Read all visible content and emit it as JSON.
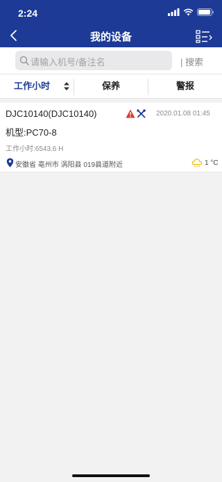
{
  "status_bar": {
    "time": "2:24"
  },
  "nav": {
    "title": "我的设备"
  },
  "search": {
    "placeholder": "请输入机号/备注名",
    "button": "| 搜索"
  },
  "tabs": [
    {
      "label": "工作小时"
    },
    {
      "label": "保养"
    },
    {
      "label": "警报"
    }
  ],
  "device": {
    "name": "DJC10140(DJC10140)",
    "model": "机型:PC70-8",
    "hours": "工作小时:6543.6 H",
    "timestamp": "2020.01.08 01:45",
    "location": "安徽省 亳州市 涡阳县 019县道附近",
    "temperature": "1 °C"
  },
  "colors": {
    "nav_bg": "#1c3a96",
    "active_tab": "#1c3a96",
    "warning": "#e03a2f",
    "weather": "#f0b400"
  }
}
